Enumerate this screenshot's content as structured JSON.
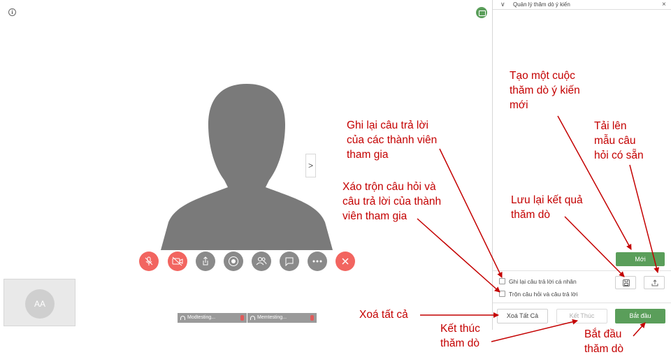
{
  "meeting": {
    "info_icon": "info-icon",
    "top_right_icon": "chat-badge-icon",
    "self_view_initials": "AA",
    "participants": [
      {
        "name": "Modtesting..."
      },
      {
        "name": "Memtesting..."
      }
    ],
    "controls": [
      {
        "icon": "mic-off-icon",
        "name": "mic-toggle-button"
      },
      {
        "icon": "camera-off-icon",
        "name": "camera-toggle-button"
      },
      {
        "icon": "share-icon",
        "name": "share-screen-button"
      },
      {
        "icon": "record-icon",
        "name": "record-button"
      },
      {
        "icon": "participants-icon",
        "name": "participants-button"
      },
      {
        "icon": "chat-icon",
        "name": "chat-button"
      },
      {
        "icon": "more-icon",
        "name": "more-options-button"
      },
      {
        "icon": "close-icon",
        "name": "leave-meeting-button"
      }
    ],
    "side_handle": ">"
  },
  "poll_panel": {
    "title": "Quản lý thăm dò ý kiến",
    "collapse_glyph": "∨",
    "close_glyph": "×",
    "new_button": "Mới",
    "checkbox_record": "Ghi lại câu trả lời cá nhân",
    "checkbox_shuffle": "Trộn câu hỏi và câu trả lời",
    "save_icon": "save-icon",
    "upload_icon": "upload-icon",
    "clear_all_button": "Xoá Tất Cả",
    "end_button": "Kết Thúc",
    "start_button": "Bắt đầu"
  },
  "annotations": {
    "new_poll": [
      "Tạo một cuộc",
      "thăm dò ý kiến",
      "mới"
    ],
    "upload_template": [
      "Tải lên",
      "mẫu câu",
      "hỏi có sẵn"
    ],
    "record_answers": [
      "Ghi lại câu trả lời",
      "của các thành viên",
      "tham gia"
    ],
    "shuffle": [
      "Xáo trộn câu hỏi và",
      "câu trả lời của thành",
      "viên tham gia"
    ],
    "save_results": [
      "Lưu lại kết quả",
      "thăm dò"
    ],
    "clear_all": [
      "Xoá tất cả"
    ],
    "end_poll": [
      "Kết thúc",
      "thăm dò"
    ],
    "start_poll": [
      "Bắt đầu",
      "thăm dò"
    ]
  },
  "colors": {
    "accent_green": "#5a9e5a",
    "control_red": "#f26560",
    "control_gray": "#8a8a8a",
    "annotation_red": "#c40000"
  }
}
